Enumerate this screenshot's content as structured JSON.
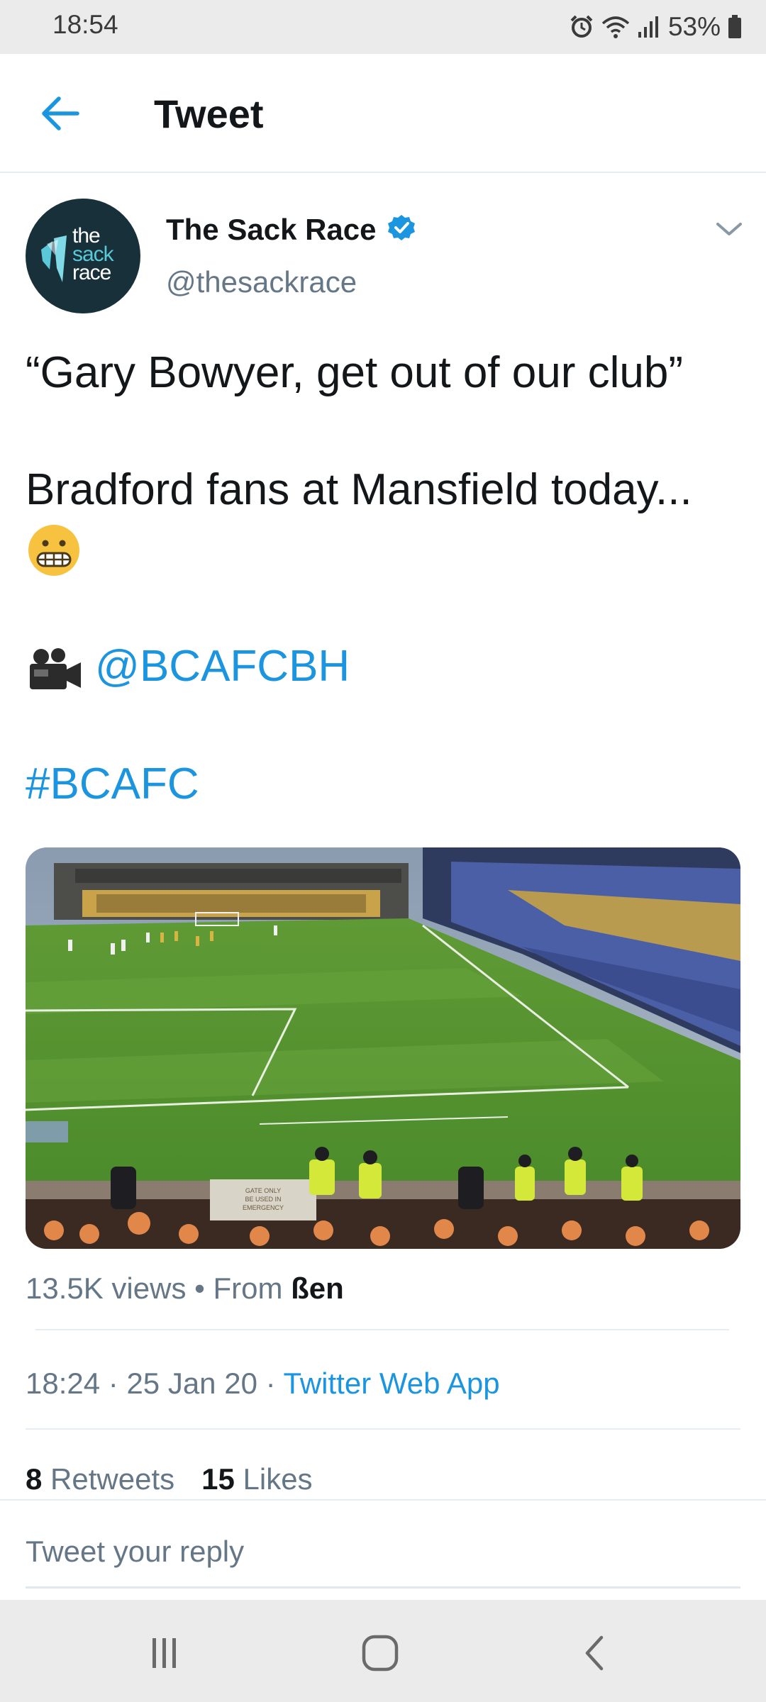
{
  "status_bar": {
    "time": "18:54",
    "battery": "53%"
  },
  "header": {
    "title": "Tweet"
  },
  "author": {
    "name": "The Sack Race",
    "handle": "@thesackrace",
    "avatar_logo": [
      "the",
      "sack",
      "race"
    ]
  },
  "tweet": {
    "line1": "“Gary Bowyer, get out of our club”",
    "line2": "Bradford fans at Mansfield today...",
    "mention": "@BCAFCBH",
    "hashtag": "#BCAFC"
  },
  "media": {
    "type": "video",
    "alt": "Football stadium with fans and stewards",
    "banner_text": [
      "GATE ONLY",
      "BE USED IN",
      "EMERGENCY"
    ]
  },
  "meta": {
    "views": "13.5K views",
    "separator": " • ",
    "from_label": "From ",
    "source": "ßen",
    "time": "18:24",
    "date": "25 Jan 20",
    "dot": " · ",
    "app": "Twitter Web App"
  },
  "stats": {
    "retweets_count": "8",
    "retweets_label": "Retweets",
    "likes_count": "15",
    "likes_label": "Likes"
  },
  "reply": {
    "placeholder": "Tweet your reply"
  },
  "colors": {
    "accent": "#1b95e0",
    "text": "#14171a",
    "muted": "#657786",
    "divider": "#e6ecf0"
  },
  "icons": {
    "status": [
      "alarm-icon",
      "wifi-icon",
      "signal-icon",
      "battery-icon"
    ],
    "nav": [
      "recent-apps-icon",
      "home-icon",
      "back-icon"
    ]
  }
}
